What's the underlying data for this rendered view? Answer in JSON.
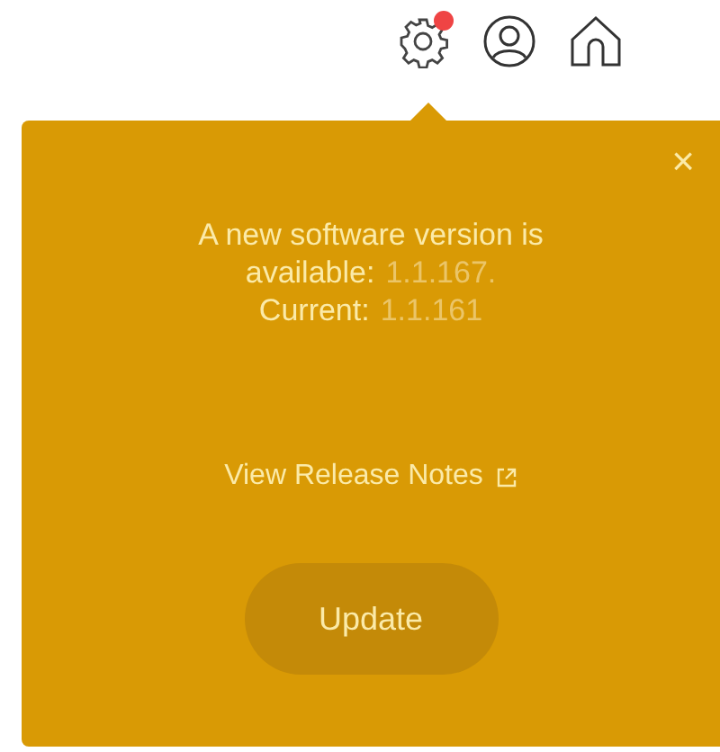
{
  "toolbar": {
    "settings_badge": true
  },
  "popup": {
    "close": "×",
    "message": "A new software version is",
    "available_label": "available:",
    "available_version": "1.1.167.",
    "current_label": "Current:",
    "current_version": "1.1.161",
    "link": "View Release Notes",
    "button": "Update"
  }
}
